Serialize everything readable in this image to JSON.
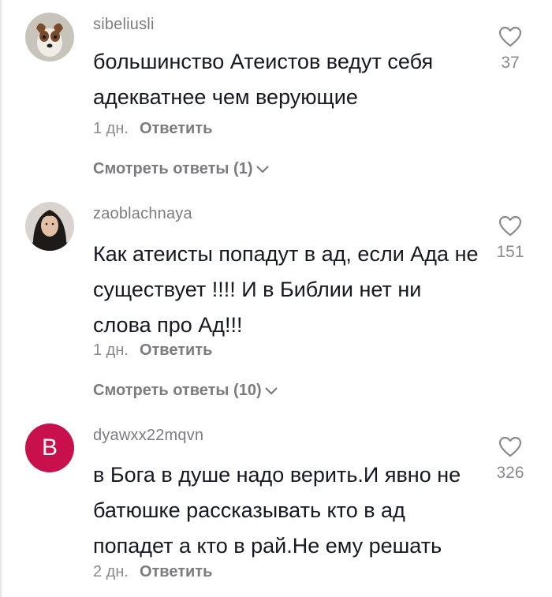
{
  "comments": [
    {
      "username": "sibeliusli",
      "text": "большинство Атеистов ведут себя адекватнее чем верующие",
      "time": "1 дн.",
      "reply_label": "Ответить",
      "likes": "37",
      "view_replies": "Смотреть ответы (1)",
      "avatar": "dog-photo"
    },
    {
      "username": "zaoblachnaya",
      "text": "Как атеисты попадут в ад, если Ада не существует !!!! И в Библии нет ни слова про Ад!!!",
      "time": "1 дн.",
      "reply_label": "Ответить",
      "likes": "151",
      "view_replies": "Смотреть ответы (10)",
      "avatar": "woman-photo"
    },
    {
      "username": "dyawxx22mqvn",
      "text": "в Бога в душе надо верить.И явно не батюшке рассказывать кто в ад попадет а кто в рай.Не ему решать",
      "time": "2 дн.",
      "reply_label": "Ответить",
      "likes": "326",
      "avatar_letter": "B",
      "avatar_color": "#c8104d"
    }
  ],
  "icons": {
    "like": "heart-outline-icon",
    "expand": "chevron-down-icon"
  }
}
